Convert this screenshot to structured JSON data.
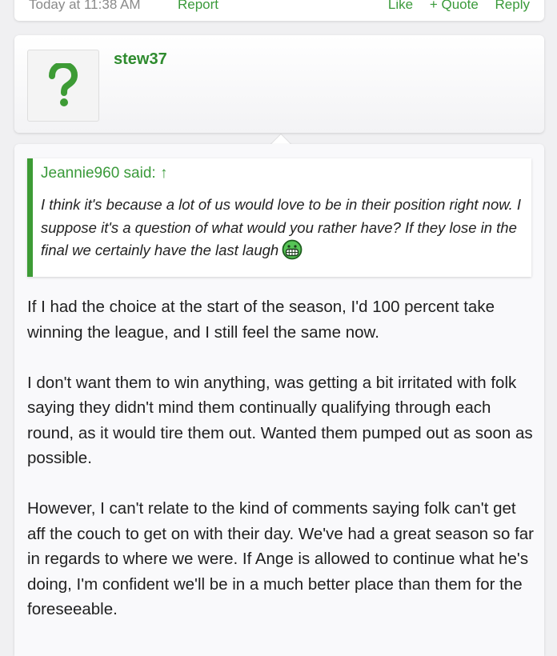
{
  "previous_post": {
    "date": "Today at 11:38 AM",
    "report_label": "Report",
    "like_label": "Like",
    "quote_label": "+ Quote",
    "reply_label": "Reply"
  },
  "post": {
    "author": "stew37",
    "quote": {
      "author_line": "Jeannie960 said: ↑",
      "text": "I think it's because a lot of us would love to be in their position right now. I suppose it's a question of what would you rather have? If they lose in the final we certainly have the last laugh",
      "emoji": "grin-emoji"
    },
    "paragraphs": [
      "If I had the choice at the start of the season, I'd 100 percent take winning the league, and I still feel the same now.",
      "I don't want them to win anything, was getting a bit irritated with folk saying they didn't mind them continually qualifying through each round, as it would tire them out. Wanted them pumped out as soon as possible.",
      "However, I can't relate to the kind of comments saying folk can't get aff the couch to get on with their day. We've had a great season so far in regards to where we were. If Ange is allowed to continue what he's doing, I'm confident we'll be in a much better place than them for the foreseeable."
    ]
  },
  "colors": {
    "accent_green": "#3d9b35",
    "link_green": "#3a9a3a",
    "text": "#1f1f1f"
  }
}
